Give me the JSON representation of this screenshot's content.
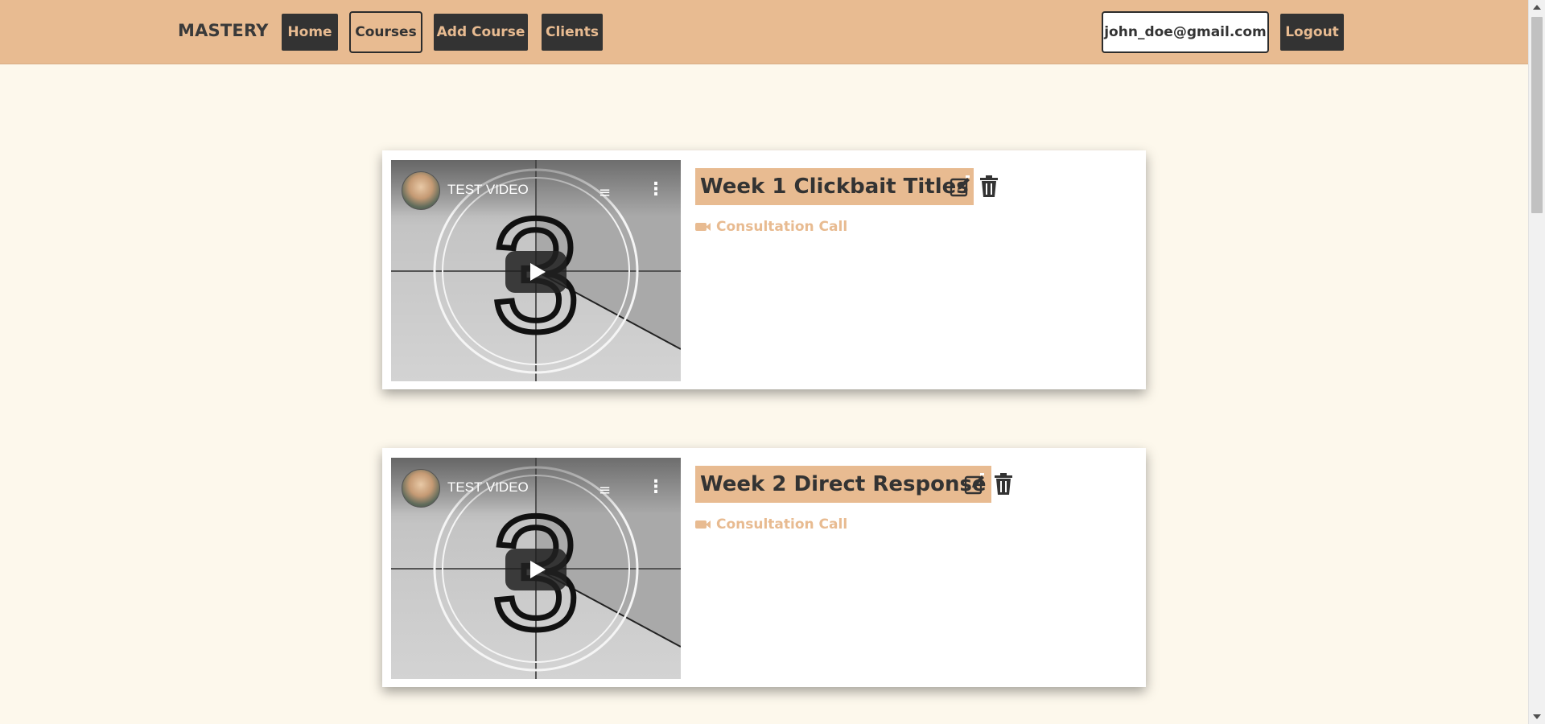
{
  "navbar": {
    "brand": "MASTERY",
    "items": [
      {
        "label": "Home"
      },
      {
        "label": "Courses"
      },
      {
        "label": "Add Course"
      },
      {
        "label": "Clients"
      }
    ],
    "user_email": "john_doe@gmail.com",
    "logout_label": "Logout"
  },
  "courses": [
    {
      "title": "Week 1 Clickbait Titles",
      "video": {
        "title": "TEST VIDEO",
        "countdown_digit": "3"
      },
      "link_label": "Consultation Call",
      "link_icon": "video-camera-icon"
    },
    {
      "title": "Week 2 Direct Response",
      "video": {
        "title": "TEST VIDEO",
        "countdown_digit": "3"
      },
      "link_label": "Consultation Call",
      "link_icon": "video-camera-icon"
    }
  ],
  "colors": {
    "accent": "#e8bb91",
    "dark": "#333333",
    "background": "#fdf8ec"
  }
}
